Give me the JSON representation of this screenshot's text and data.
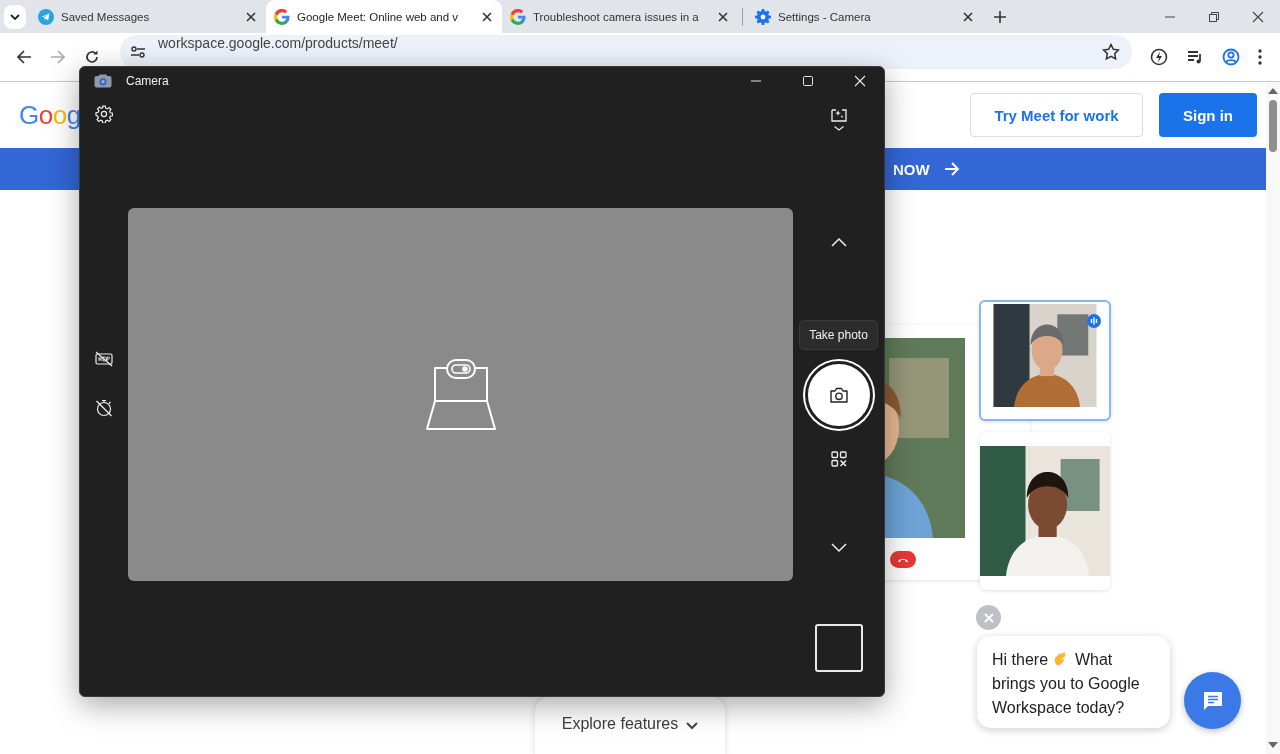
{
  "browser": {
    "tabs": [
      {
        "title": "Saved Messages",
        "kind": "telegram",
        "selected": false
      },
      {
        "title": "Google Meet: Online web and v",
        "kind": "google",
        "selected": true
      },
      {
        "title": "Troubleshoot camera issues in a",
        "kind": "google",
        "selected": false
      },
      {
        "title": "Settings - Camera",
        "kind": "settings",
        "selected": false
      }
    ],
    "address": "workspace.google.com/products/meet/"
  },
  "page": {
    "logo": "Goog",
    "buttons": [
      {
        "label": "Try Meet for work",
        "kind": "outline"
      },
      {
        "label": "Sign in",
        "kind": "filled"
      }
    ],
    "banner": "NOW",
    "explore": "Explore features",
    "chat": {
      "greeting": "Hi there",
      "question": "What brings you to Google Workspace today?"
    }
  },
  "camera_window": {
    "title": "Camera",
    "tooltip": "Take photo"
  }
}
